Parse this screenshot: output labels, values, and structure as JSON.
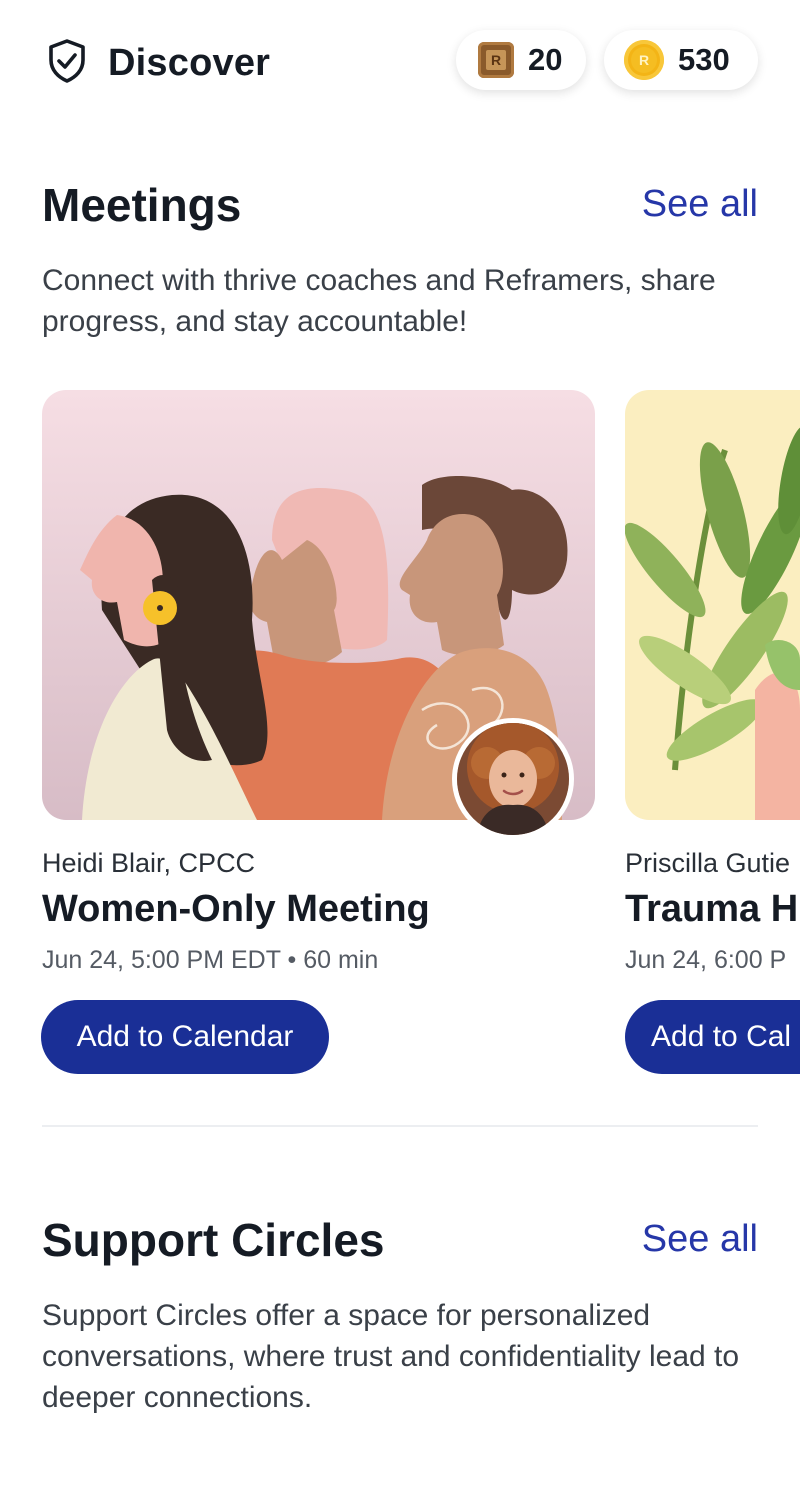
{
  "header": {
    "title": "Discover",
    "title_icon": "shield-check-icon",
    "badges": [
      {
        "icon": "r-token-icon",
        "glyph": "R",
        "value": "20"
      },
      {
        "icon": "coin-icon",
        "glyph": "R",
        "value": "530"
      }
    ]
  },
  "meetings": {
    "title": "Meetings",
    "see_all": "See all",
    "description": "Connect with thrive coaches and Reframers, share progress, and stay accountable!",
    "cards": [
      {
        "host": "Heidi Blair, CPCC",
        "title": "Women-Only Meeting",
        "meta": "Jun 24, 5:00 PM EDT • 60 min",
        "button": "Add to Calendar"
      },
      {
        "host": "Priscilla Gutie",
        "title": "Trauma H",
        "meta": "Jun 24, 6:00 P",
        "button": "Add to Cal"
      }
    ]
  },
  "support_circles": {
    "title": "Support Circles",
    "see_all": "See all",
    "description": "Support Circles offer a space for personalized conversations, where trust and confidentiality lead to deeper connections."
  },
  "colors": {
    "primary_button": "#1a2f96",
    "link": "#2637a8",
    "text_dark": "#151b24"
  }
}
